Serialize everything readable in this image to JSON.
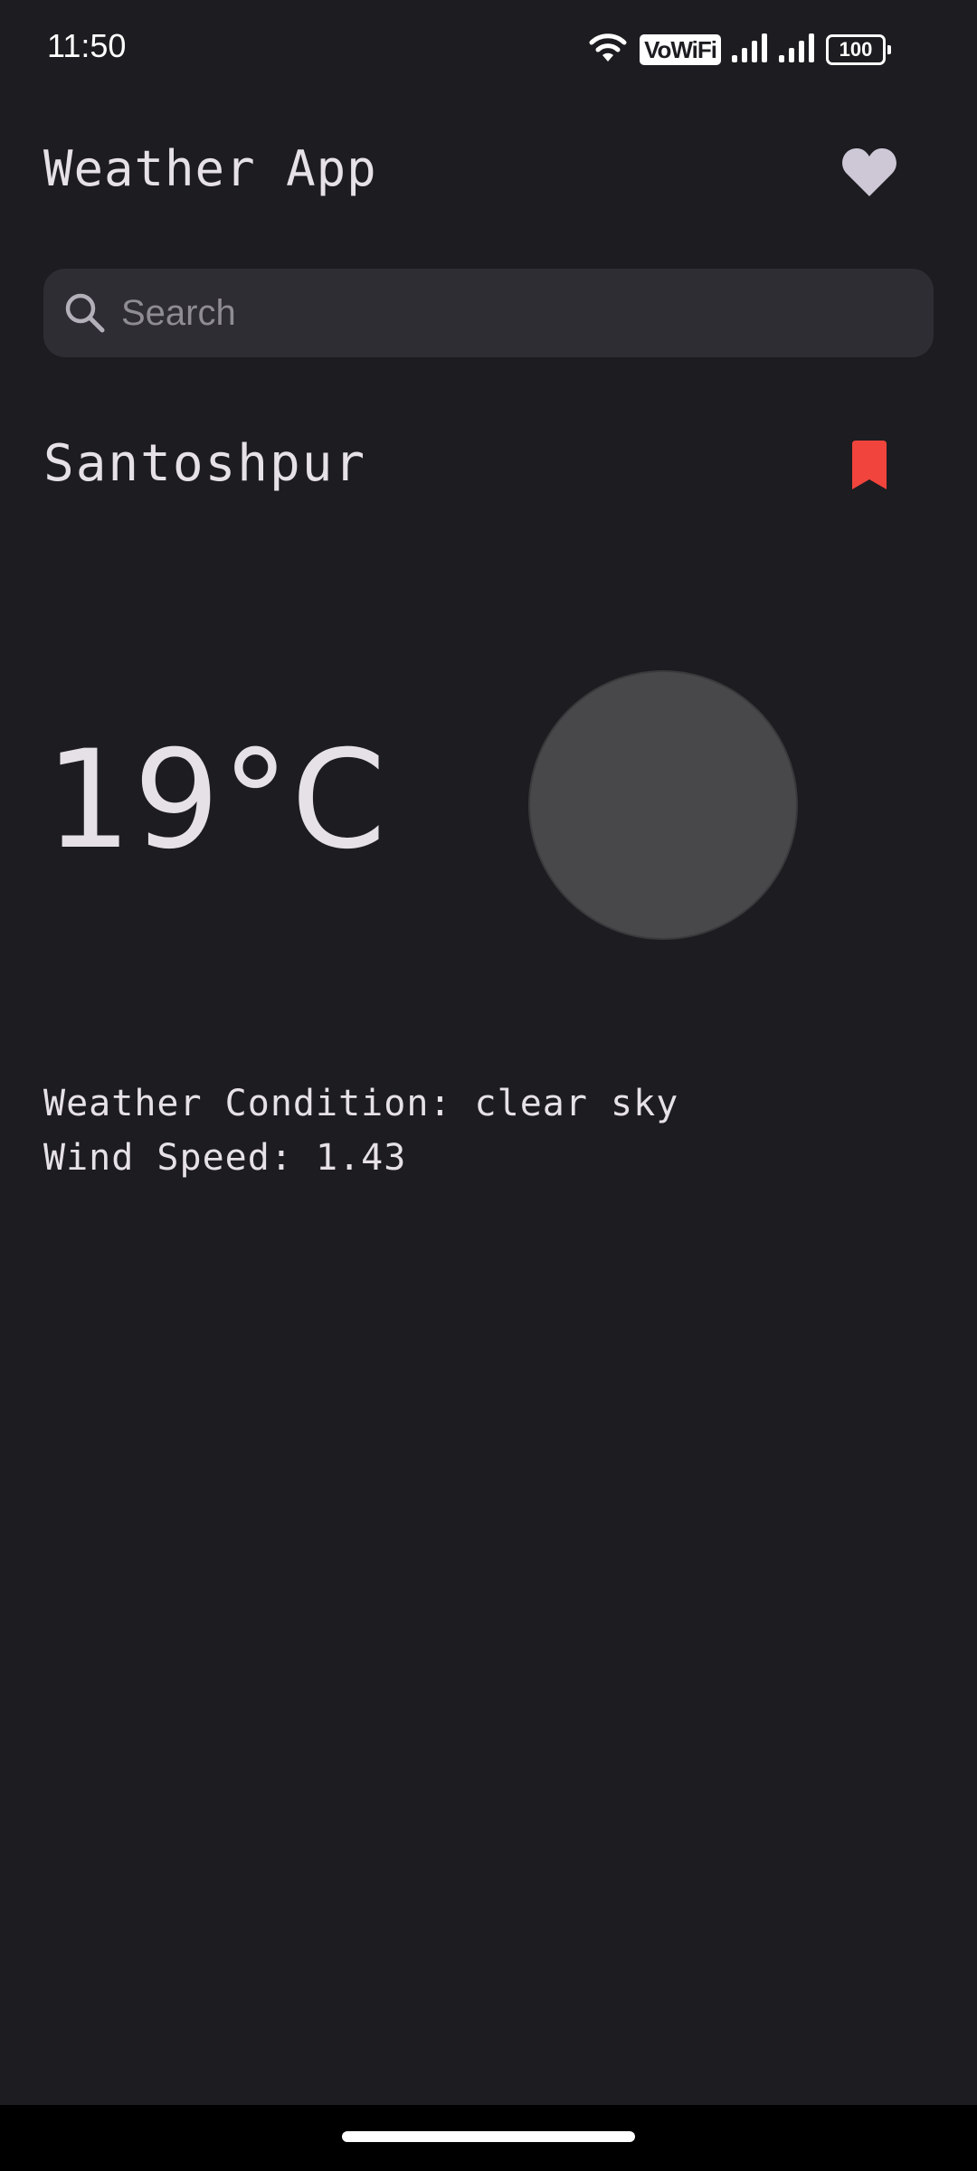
{
  "status_bar": {
    "time": "11:50",
    "vowifi_label": "VoWiFi",
    "battery_level": "100",
    "icons": [
      "wifi-icon",
      "vowifi-icon",
      "signal-icon",
      "signal-icon",
      "battery-icon"
    ]
  },
  "app_bar": {
    "title": "Weather App",
    "favorites_icon": "heart-icon"
  },
  "search": {
    "placeholder": "Search",
    "value": ""
  },
  "location": {
    "city": "Santoshpur",
    "bookmark_icon": "bookmark-icon",
    "bookmark_color": "#f0443c"
  },
  "weather": {
    "temperature": "19°C",
    "icon": "weather-condition-icon",
    "condition_text": "Weather Condition: clear sky",
    "wind_text": "Wind Speed: 1.43"
  },
  "colors": {
    "background": "#1d1c21",
    "surface": "#2e2d33",
    "text": "#e6e1e6",
    "heart": "#cdc7d6",
    "accent_red": "#f0443c"
  }
}
